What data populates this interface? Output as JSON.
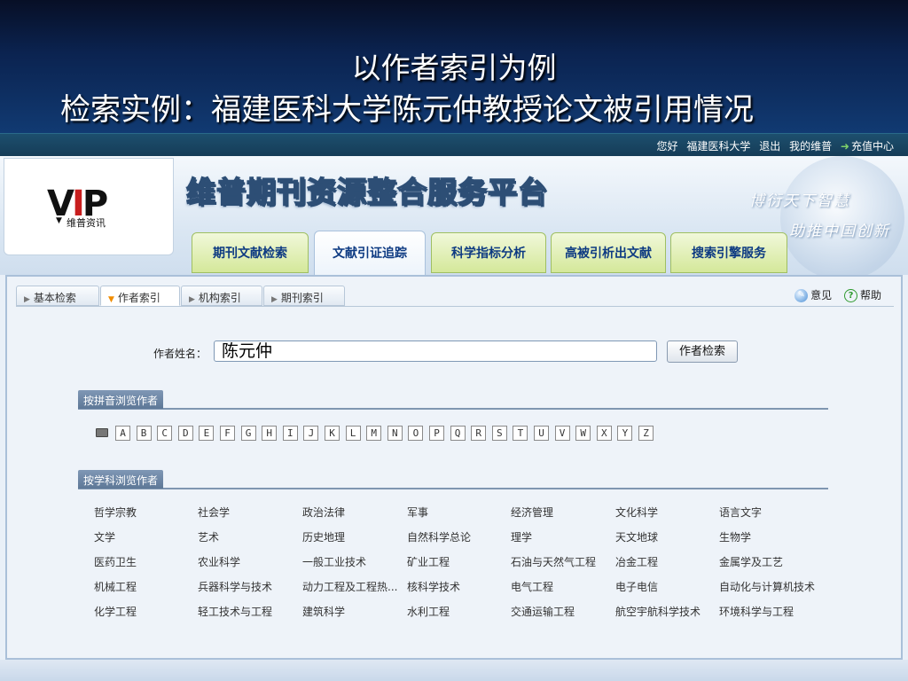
{
  "slide": {
    "title_line1": "以作者索引为例",
    "title_line2": "检索实例：福建医科大学陈元仲教授论文被引用情况"
  },
  "topbar": {
    "greeting": "您好",
    "user": "福建医科大学",
    "logout": "退出",
    "my_vip": "我的维普",
    "recharge": "充值中心"
  },
  "logo": {
    "mark_v": "V",
    "mark_i": "I",
    "mark_p": "P",
    "sub": "维普资讯"
  },
  "platform_title": "维普期刊资源整合服务平台",
  "slogan": [
    "博衍天下智慧",
    "助推中国创新"
  ],
  "main_tabs": [
    "期刊文献检索",
    "文献引证追踪",
    "科学指标分析",
    "高被引析出文献",
    "搜索引擎服务"
  ],
  "active_main_tab": "文献引证追踪",
  "sub_tabs": [
    "基本检索",
    "作者索引",
    "机构索引",
    "期刊索引"
  ],
  "active_sub_tab": "作者索引",
  "help_links": {
    "opinion": "意见",
    "help": "帮助"
  },
  "search": {
    "label": "作者姓名：",
    "value": "陈元仲",
    "button": "作者检索"
  },
  "pinyin_section": {
    "title": "按拼音浏览作者",
    "letters": [
      "A",
      "B",
      "C",
      "D",
      "E",
      "F",
      "G",
      "H",
      "I",
      "J",
      "K",
      "L",
      "M",
      "N",
      "O",
      "P",
      "Q",
      "R",
      "S",
      "T",
      "U",
      "V",
      "W",
      "X",
      "Y",
      "Z"
    ]
  },
  "subject_section": {
    "title": "按学科浏览作者",
    "rows": [
      [
        "哲学宗教",
        "社会学",
        "政治法律",
        "军事",
        "经济管理",
        "文化科学",
        "语言文字"
      ],
      [
        "文学",
        "艺术",
        "历史地理",
        "自然科学总论",
        "理学",
        "天文地球",
        "生物学"
      ],
      [
        "医药卫生",
        "农业科学",
        "一般工业技术",
        "矿业工程",
        "石油与天然气工程",
        "冶金工程",
        "金属学及工艺"
      ],
      [
        "机械工程",
        "兵器科学与技术",
        "动力工程及工程热...",
        "核科学技术",
        "电气工程",
        "电子电信",
        "自动化与计算机技术"
      ],
      [
        "化学工程",
        "轻工技术与工程",
        "建筑科学",
        "水利工程",
        "交通运输工程",
        "航空宇航科学技术",
        "环境科学与工程"
      ]
    ]
  },
  "colors": {
    "slide_bg": "#0b2350",
    "tab_green": "#d4e89a",
    "tab_text": "#0d3a82",
    "section_head": "#6a83a3"
  }
}
